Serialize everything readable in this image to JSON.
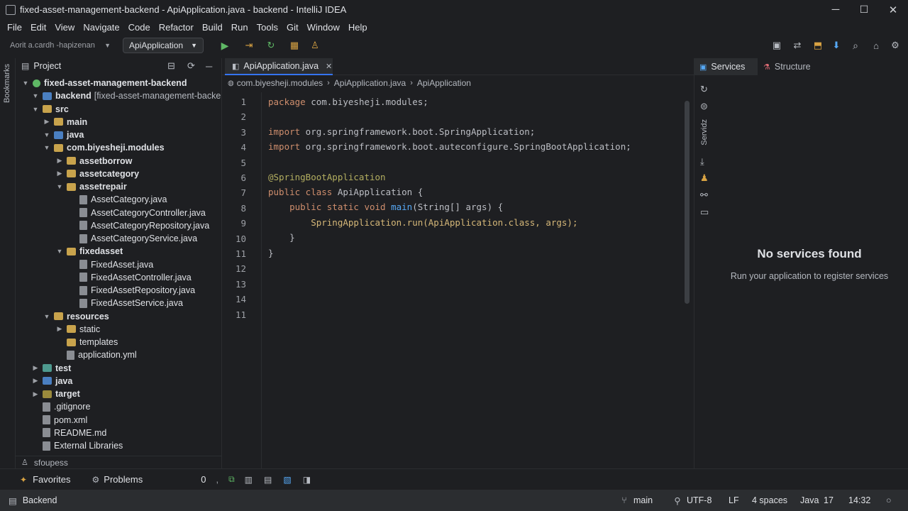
{
  "window": {
    "title": "fixed-asset-management-backend - ApiApplication.java - backend - IntelliJ IDEA",
    "minimize": "─",
    "maximize": "☐",
    "close": "✕"
  },
  "menu": [
    "File",
    "Edit",
    "View",
    "Navigate",
    "Code",
    "Refactor",
    "Build",
    "Run",
    "Tools",
    "Git",
    "Window",
    "Help"
  ],
  "toolbar": {
    "search_placeholder": "Aorit a.cardh -hapizenan",
    "run_config": "ApiApplication",
    "run_icon": "play-icon"
  },
  "left_strip_label": "Bookmarks",
  "project": {
    "title": "Project",
    "tree": [
      {
        "label": "fixed-asset-management-backend",
        "level": 0,
        "arrow": "▼",
        "icon": "module",
        "bold": true
      },
      {
        "label": "backend",
        "suffix": "[fixed-asset-management-backend]",
        "level": 1,
        "arrow": "▼",
        "icon": "folder-blue",
        "bold": true
      },
      {
        "label": "src",
        "level": 1,
        "arrow": "▼",
        "icon": "folder",
        "bold": true
      },
      {
        "label": "main",
        "level": 2,
        "arrow": "▶",
        "icon": "folder",
        "bold": true
      },
      {
        "label": "java",
        "level": 2,
        "arrow": "▼",
        "icon": "folder-blue",
        "bold": true
      },
      {
        "label": "com.biyesheji.modules",
        "level": 2,
        "arrow": "▼",
        "icon": "folder",
        "bold": true
      },
      {
        "label": "assetborrow",
        "level": 3,
        "arrow": "▶",
        "icon": "folder",
        "bold": true
      },
      {
        "label": "assetcategory",
        "level": 3,
        "arrow": "▶",
        "icon": "folder",
        "bold": true
      },
      {
        "label": "assetrepair",
        "level": 3,
        "arrow": "▼",
        "icon": "folder",
        "bold": true
      },
      {
        "label": "AssetCategory.java",
        "level": 4,
        "arrow": "",
        "icon": "file",
        "bold": false
      },
      {
        "label": "AssetCategoryController.java",
        "level": 4,
        "arrow": "",
        "icon": "file",
        "bold": false
      },
      {
        "label": "AssetCategoryRepository.java",
        "level": 4,
        "arrow": "",
        "icon": "file",
        "bold": false
      },
      {
        "label": "AssetCategoryService.java",
        "level": 4,
        "arrow": "",
        "icon": "file",
        "bold": false
      },
      {
        "label": "fixedasset",
        "level": 3,
        "arrow": "▼",
        "icon": "folder",
        "bold": true
      },
      {
        "label": "FixedAsset.java",
        "level": 4,
        "arrow": "",
        "icon": "file",
        "bold": false
      },
      {
        "label": "FixedAssetController.java",
        "level": 4,
        "arrow": "",
        "icon": "file",
        "bold": false
      },
      {
        "label": "FixedAssetRepository.java",
        "level": 4,
        "arrow": "",
        "icon": "file",
        "bold": false
      },
      {
        "label": "FixedAssetService.java",
        "level": 4,
        "arrow": "",
        "icon": "file",
        "bold": false
      },
      {
        "label": "resources",
        "level": 2,
        "arrow": "▼",
        "icon": "folder",
        "bold": true
      },
      {
        "label": "static",
        "level": 3,
        "arrow": "▶",
        "icon": "folder",
        "bold": false
      },
      {
        "label": "templates",
        "level": 3,
        "arrow": "",
        "icon": "folder",
        "bold": false
      },
      {
        "label": "application.yml",
        "level": 3,
        "arrow": "",
        "icon": "file",
        "bold": false
      },
      {
        "label": "test",
        "level": 1,
        "arrow": "▶",
        "icon": "folder-teal",
        "bold": true
      },
      {
        "label": "java",
        "level": 1,
        "arrow": "▶",
        "icon": "folder-blue",
        "bold": true
      },
      {
        "label": "target",
        "level": 1,
        "arrow": "▶",
        "icon": "folder-olive",
        "bold": true
      },
      {
        "label": ".gitignore",
        "level": 1,
        "arrow": "",
        "icon": "file",
        "bold": false
      },
      {
        "label": "pom.xml",
        "level": 1,
        "arrow": "",
        "icon": "file",
        "bold": false
      },
      {
        "label": "README.md",
        "level": 1,
        "arrow": "",
        "icon": "file",
        "bold": false
      },
      {
        "label": "External Libraries",
        "level": 1,
        "arrow": "",
        "icon": "file",
        "bold": false
      }
    ],
    "footer": "sfoupess"
  },
  "editor": {
    "tab": "ApiApplication.java",
    "tab_close": "✕",
    "breadcrumbs": [
      "com.biyesheji.modules",
      "ApiApplication.java",
      "ApiApplication"
    ],
    "line_numbers": [
      "1",
      "2",
      "3",
      "4",
      "5",
      "6",
      "7",
      "8",
      "9",
      "10",
      "11",
      "12",
      "13",
      "14",
      "11"
    ],
    "code": {
      "l1a": "package",
      "l1b": " com.biyesheji.modules;",
      "l3a": "import",
      "l3b": " org.springframework.boot.SpringApplication;",
      "l4a": "import",
      "l4b": " org.springframework.boot.auteconfigure.SpringBootApplication;",
      "l6": "@SpringBootApplication",
      "l7a": "public class",
      "l7b": " ApiApplication {",
      "l8a": "    public static void",
      "l8b": " main",
      "l8c": "(String[] args) {",
      "l9": "        SpringApplication.run(ApiApplication.class, args);",
      "l10": "    }",
      "l11": "}"
    }
  },
  "right": {
    "tab_services": "Services",
    "tab_structure": "Structure",
    "vertical_label": "Servidz",
    "empty_title": "No services found",
    "empty_sub": "Run your application to register services"
  },
  "bottom": {
    "favorites": "Favorites",
    "problems": "Problems",
    "count": "0",
    "sep": ","
  },
  "status": {
    "project": "Backend",
    "branch": "main",
    "encoding": "UTF-8",
    "line_sep": "LF",
    "indent": "4 spaces",
    "lang": "Java",
    "lang_ver": "17",
    "time": "14:32"
  }
}
